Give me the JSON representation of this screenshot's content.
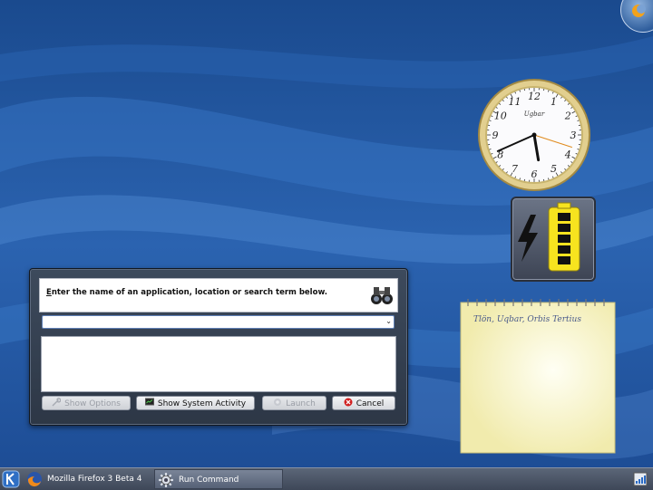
{
  "colors": {
    "wallpaper": "#1d4f96",
    "dialog_frame": "#3d4a5c",
    "taskbar": "#4b5568",
    "cancel_red": "#d11e1e"
  },
  "clock": {
    "brand": "Ugbar",
    "numbers": [
      "12",
      "1",
      "2",
      "3",
      "4",
      "5",
      "6",
      "7",
      "8",
      "9",
      "10",
      "11"
    ],
    "time_hour": 5,
    "time_minute": 41,
    "second": 18
  },
  "battery": {
    "icon": "battery-charging-icon"
  },
  "notes": {
    "text": "Tlön, Uqbar, Orbis Tertius"
  },
  "dialog": {
    "prompt_first": "E",
    "prompt_rest": "nter the name of an application, location or search term below.",
    "input_value": "",
    "buttons": {
      "options": "Show Options",
      "activity": "Show System Activity",
      "launch": "Launch",
      "cancel": "Cancel"
    }
  },
  "taskbar": {
    "tasks": [
      {
        "label": "Mozilla Firefox 3 Beta 4"
      },
      {
        "label": "Run Command"
      }
    ]
  }
}
